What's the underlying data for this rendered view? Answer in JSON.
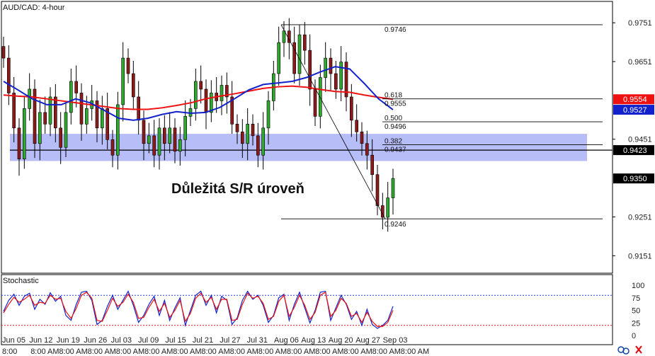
{
  "chart_data": [
    {
      "type": "candlestick",
      "title": "AUD/CAD: 4-hour",
      "ylim": [
        0.9106,
        0.9806
      ],
      "y_ticks": [
        0.9751,
        0.9651,
        0.9554,
        0.9527,
        0.9451,
        0.9423,
        0.935,
        0.9251,
        0.9151
      ],
      "x_date_labels": [
        "Jun 05",
        "Jun 12",
        "Jun 19",
        "Jun 26",
        "Jul 03",
        "Jul 09",
        "Jul 15",
        "Jul 21",
        "Jul 27",
        "Jul 31",
        "Aug 06",
        "Aug 13",
        "Aug 20",
        "Aug 27",
        "Sep 03"
      ],
      "x_time_labels": [
        "8:00",
        "8:00 AM",
        "8:00 AM",
        "8:00 AM",
        "8:00 AM",
        "8:00 AM",
        "8:00 AM",
        "8:00 AM",
        "8:00 AM",
        "8:00 AM",
        "8:00 AM",
        "8:00 AM",
        "8:00 AM",
        "8:00 AM",
        "8:00 AM"
      ],
      "current_price": 0.935,
      "price_tags": [
        {
          "value": 0.9554,
          "color": "#ee1111"
        },
        {
          "value": 0.9527,
          "color": "#1122cc"
        },
        {
          "value": 0.9423,
          "color": "#000000"
        },
        {
          "value": 0.935,
          "color": "#000000"
        }
      ],
      "close_series": [
        0.966,
        0.957,
        0.948,
        0.94,
        0.953,
        0.958,
        0.944,
        0.952,
        0.949,
        0.956,
        0.948,
        0.943,
        0.952,
        0.96,
        0.957,
        0.949,
        0.953,
        0.955,
        0.948,
        0.953,
        0.945,
        0.941,
        0.954,
        0.966,
        0.962,
        0.956,
        0.95,
        0.944,
        0.946,
        0.941,
        0.948,
        0.944,
        0.948,
        0.942,
        0.945,
        0.951,
        0.953,
        0.96,
        0.958,
        0.952,
        0.957,
        0.955,
        0.959,
        0.956,
        0.949,
        0.947,
        0.944,
        0.949,
        0.946,
        0.941,
        0.948,
        0.955,
        0.962,
        0.97,
        0.973,
        0.97,
        0.962,
        0.972,
        0.968,
        0.958,
        0.951,
        0.961,
        0.966,
        0.962,
        0.958,
        0.965,
        0.956,
        0.95,
        0.947,
        0.944,
        0.941,
        0.936,
        0.928,
        0.925,
        0.93,
        0.935
      ],
      "moving_averages": [
        {
          "color": "#ee1111",
          "values": [
            0.9565,
            0.9562,
            0.956,
            0.9555,
            0.955,
            0.9545,
            0.954,
            0.9535,
            0.953,
            0.9528,
            0.9528,
            0.9532,
            0.9538,
            0.9545,
            0.9555,
            0.9562,
            0.9568,
            0.9575,
            0.9582,
            0.9586,
            0.9588,
            0.9585,
            0.9579,
            0.9574,
            0.9572,
            0.9565,
            0.9559,
            0.9554
          ]
        },
        {
          "color": "#1122cc",
          "values": [
            0.96,
            0.9578,
            0.9555,
            0.954,
            0.954,
            0.9555,
            0.9545,
            0.9525,
            0.9505,
            0.95,
            0.9505,
            0.9515,
            0.9522,
            0.9518,
            0.952,
            0.9533,
            0.9555,
            0.9578,
            0.9592,
            0.9596,
            0.96,
            0.961,
            0.9625,
            0.9638,
            0.9632,
            0.9595,
            0.9555,
            0.9527
          ]
        }
      ],
      "fibonacci": {
        "high": 0.9746,
        "low": 0.9246,
        "levels": [
          {
            "ratio": "0.618",
            "value": 0.9555
          },
          {
            "ratio": "0.500",
            "value": 0.9496
          },
          {
            "ratio": "0.382",
            "value": 0.9437
          }
        ]
      },
      "sr_zone": {
        "from": 0.9395,
        "to": 0.9465,
        "line": 0.9423
      },
      "annotation": "Důležitá S/R úroveň"
    },
    {
      "type": "line",
      "title": "Stochastic",
      "ylim": [
        0,
        100
      ],
      "y_ticks": [
        100,
        75,
        50,
        25,
        0
      ],
      "levels": [
        80,
        20
      ],
      "series": [
        {
          "color": "#1122cc",
          "values": [
            48,
            70,
            82,
            60,
            78,
            84,
            52,
            72,
            62,
            85,
            68,
            78,
            40,
            30,
            62,
            86,
            88,
            70,
            22,
            30,
            58,
            80,
            52,
            70,
            88,
            60,
            26,
            40,
            62,
            78,
            40,
            70,
            30,
            55,
            75,
            20,
            50,
            80,
            88,
            60,
            80,
            45,
            78,
            70,
            22,
            35,
            70,
            88,
            72,
            80,
            60,
            26,
            40,
            75,
            82,
            30,
            62,
            86,
            55,
            25,
            50,
            86,
            88,
            30,
            55,
            80,
            62,
            32,
            48,
            20,
            52,
            22,
            14,
            20,
            30,
            58
          ]
        },
        {
          "color": "#ee1111",
          "values": [
            45,
            62,
            76,
            66,
            72,
            80,
            60,
            66,
            64,
            80,
            72,
            74,
            48,
            34,
            54,
            80,
            86,
            74,
            30,
            28,
            50,
            74,
            58,
            66,
            82,
            66,
            34,
            36,
            56,
            72,
            48,
            64,
            36,
            50,
            70,
            28,
            44,
            74,
            84,
            66,
            76,
            52,
            72,
            72,
            30,
            32,
            62,
            84,
            74,
            78,
            64,
            32,
            38,
            68,
            80,
            38,
            56,
            80,
            60,
            32,
            46,
            80,
            86,
            38,
            50,
            74,
            64,
            38,
            44,
            26,
            46,
            28,
            18,
            18,
            26,
            50
          ]
        }
      ]
    }
  ],
  "icons": {
    "link_icon": "link-icon",
    "close_icon": "close-icon"
  }
}
